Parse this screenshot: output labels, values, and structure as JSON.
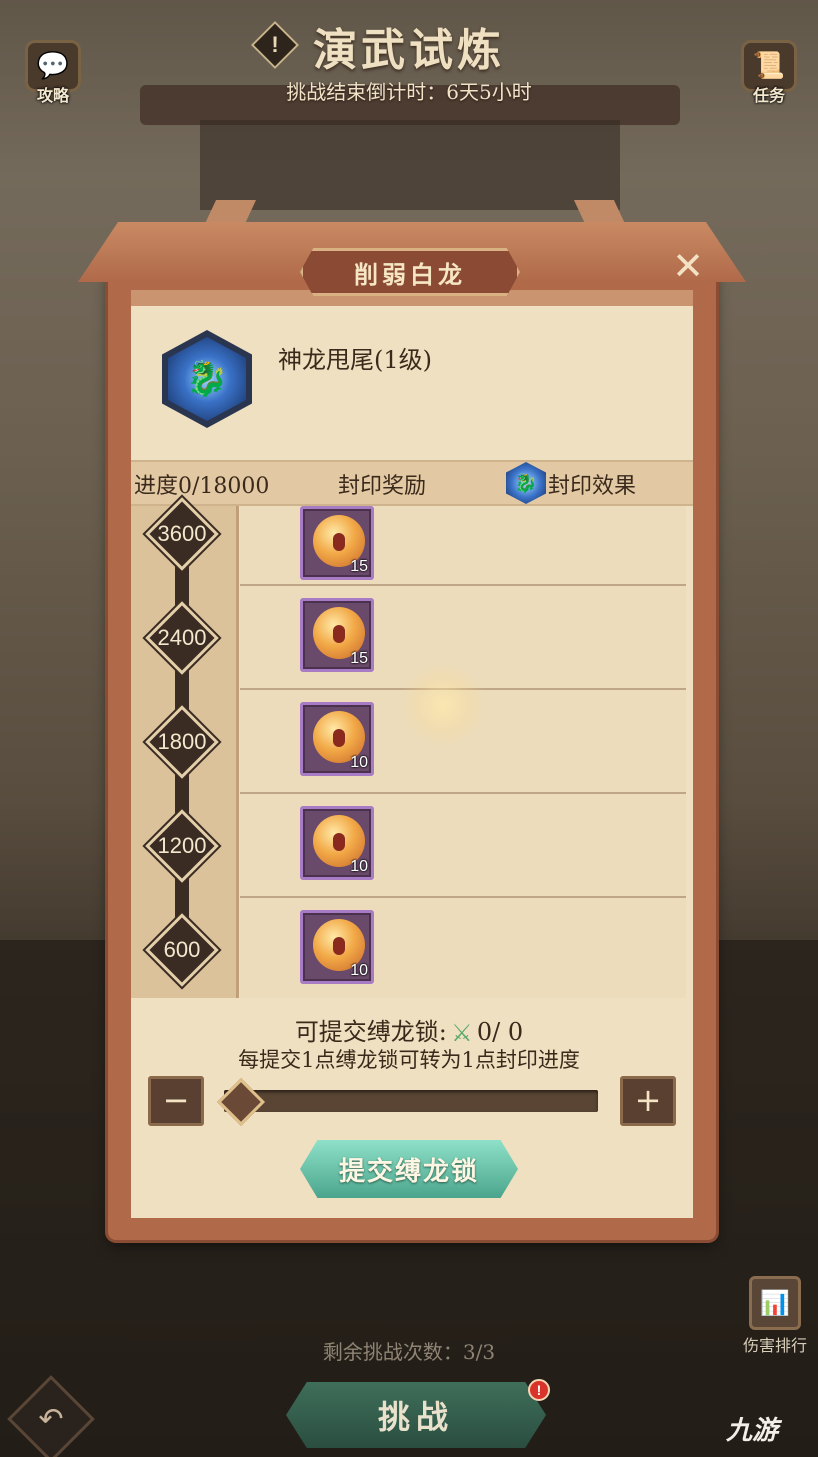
{
  "header": {
    "title": "演武试炼",
    "alert_glyph": "!",
    "countdown": "挑战结束倒计时：6天5小时",
    "strategy_label": "攻略",
    "task_label": "任务"
  },
  "modal": {
    "title": "削弱白龙",
    "close_glyph": "✕",
    "skill_name": "神龙甩尾(1级)",
    "progress": "进度0/18000",
    "progress_value": 0,
    "progress_max": 18000,
    "reward_label": "封印奖励",
    "effect_label": "封印效果",
    "milestones": [
      {
        "threshold": "3600",
        "reward_qty": "15"
      },
      {
        "threshold": "2400",
        "reward_qty": "15"
      },
      {
        "threshold": "1800",
        "reward_qty": "10"
      },
      {
        "threshold": "1200",
        "reward_qty": "10"
      },
      {
        "threshold": "600",
        "reward_qty": "10"
      }
    ],
    "submit": {
      "submittable_label": "可提交缚龙锁:",
      "submittable_count": "0/ 0",
      "conversion_note": "每提交1点缚龙锁可转为1点封印进度",
      "minus_glyph": "−",
      "plus_glyph": "+",
      "slider_value": 0,
      "button_label": "提交缚龙锁"
    }
  },
  "footer": {
    "remaining": "剩余挑战次数：3/3",
    "challenge_label": "挑战",
    "challenge_alert": "!",
    "rank_label": "伤害排行",
    "back_glyph": "↶",
    "watermark": "九游"
  },
  "colors": {
    "frame": "#b06a4a",
    "parchment": "#efe0c1",
    "submit_button": "#4aa58c",
    "challenge_button": "#2a4e40",
    "reward_border": "#a87cc4"
  },
  "icons": {
    "skill": "dragon-skill-icon",
    "effect": "dragon-effect-icon",
    "reward": "seal-medal-icon",
    "lock": "dragon-lock-icon",
    "rank": "rank-chart-icon",
    "back": "back-arrow-icon"
  }
}
